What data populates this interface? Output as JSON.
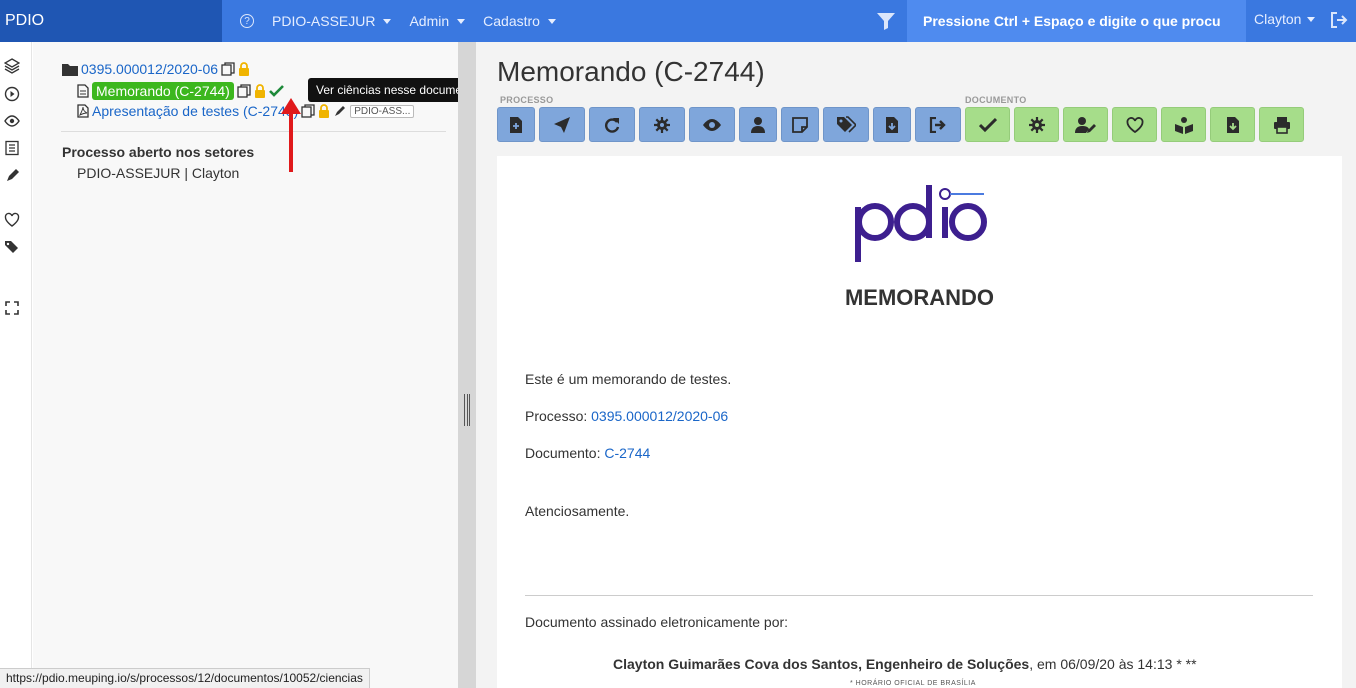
{
  "navbar": {
    "brand": "PDIO",
    "menus": [
      {
        "label": "PDIO-ASSEJUR"
      },
      {
        "label": "Admin"
      },
      {
        "label": "Cadastro"
      }
    ],
    "search_text": "Pressione Ctrl + Espaço e digite o que procu",
    "user": "Clayton",
    "accent": "#3a78e0",
    "brand_bg": "#1f56b3"
  },
  "rail_icons": [
    "layers-icon",
    "play-circle-icon",
    "eye-icon",
    "list-icon",
    "pen-icon",
    "heart-icon",
    "tags-icon",
    "expand-icon"
  ],
  "tree": {
    "process": "0395.000012/2020-06",
    "documents": [
      {
        "label": "Memorando (C-2744)",
        "selected": true
      },
      {
        "label": "Apresentação de testes (C-2745)",
        "tag": "PDIO-ASS..."
      }
    ],
    "section_title": "Processo aberto nos setores",
    "section_value": "PDIO-ASSEJUR | Clayton"
  },
  "tooltip": "Ver ciências nesse documento",
  "main": {
    "title": "Memorando (C-2744)",
    "group_process": "PROCESSO",
    "group_document": "DOCUMENTO"
  },
  "document": {
    "heading": "MEMORANDO",
    "body": "Este é um memorando de testes.",
    "processo_label": "Processo:",
    "processo_value": "0395.000012/2020-06",
    "documento_label": "Documento:",
    "documento_value": "C-2744",
    "closing": "Atenciosamente.",
    "signed_by": "Documento assinado eletronicamente por:",
    "signer": "Clayton Guimarães Cova dos Santos, Engenheiro de Soluções",
    "signed_at": ", em 06/09/20 às 14:13 * **",
    "footnote": "* HORÁRIO OFICIAL DE BRASÍLIA"
  },
  "statusbar": "https://pdio.meuping.io/s/processos/12/documentos/10052/ciencias"
}
